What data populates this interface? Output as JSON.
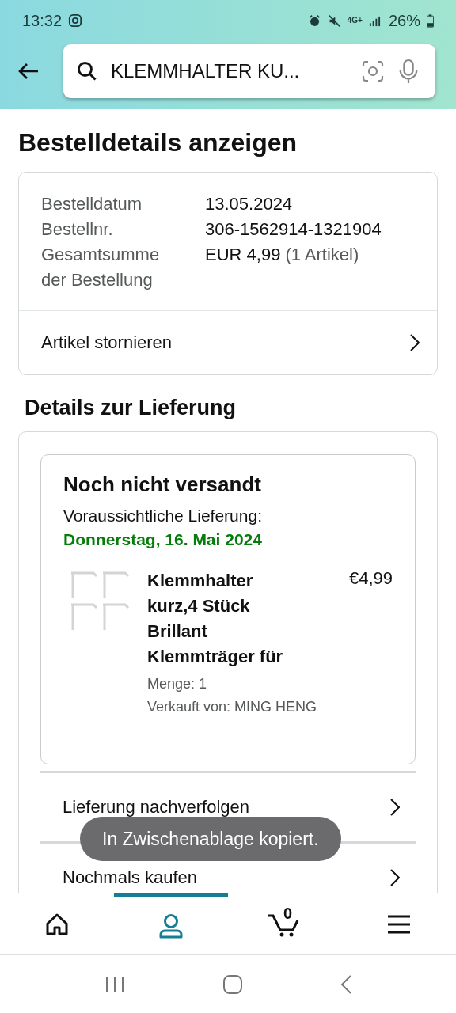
{
  "status_bar": {
    "time": "13:32",
    "battery": "26%",
    "network": "4G+"
  },
  "search": {
    "value": "KLEMMHALTER KU..."
  },
  "page_title": "Bestelldetails anzeigen",
  "order_summary": {
    "rows": [
      {
        "label": "Bestelldatum",
        "value": "13.05.2024"
      },
      {
        "label": "Bestellnr.",
        "value": "306-1562914-1321904"
      },
      {
        "label": "Gesamtsumme der Bestellung",
        "value": "EUR 4,99",
        "note": "(1 Artikel)"
      }
    ],
    "action": "Artikel stornieren"
  },
  "delivery_title": "Details zur Lieferung",
  "shipment": {
    "status": "Noch nicht versandt",
    "eta_label": "Voraussichtliche Lieferung:",
    "eta_date": "Donnerstag, 16. Mai 2024",
    "item": {
      "title": "Klemmhalter kurz,4 Stück Brillant Klemmträger für",
      "price": "€4,99",
      "quantity": "Menge: 1",
      "seller": "Verkauft von: MING HENG"
    }
  },
  "delivery_actions": [
    "Lieferung nachverfolgen",
    "Nochmals kaufen"
  ],
  "toast": "In Zwischenablage kopiert.",
  "bottom_nav": [
    {
      "kind": "home",
      "selected": false
    },
    {
      "kind": "account",
      "selected": true
    },
    {
      "kind": "cart",
      "selected": false,
      "count": "0"
    },
    {
      "kind": "menu",
      "selected": false
    }
  ]
}
